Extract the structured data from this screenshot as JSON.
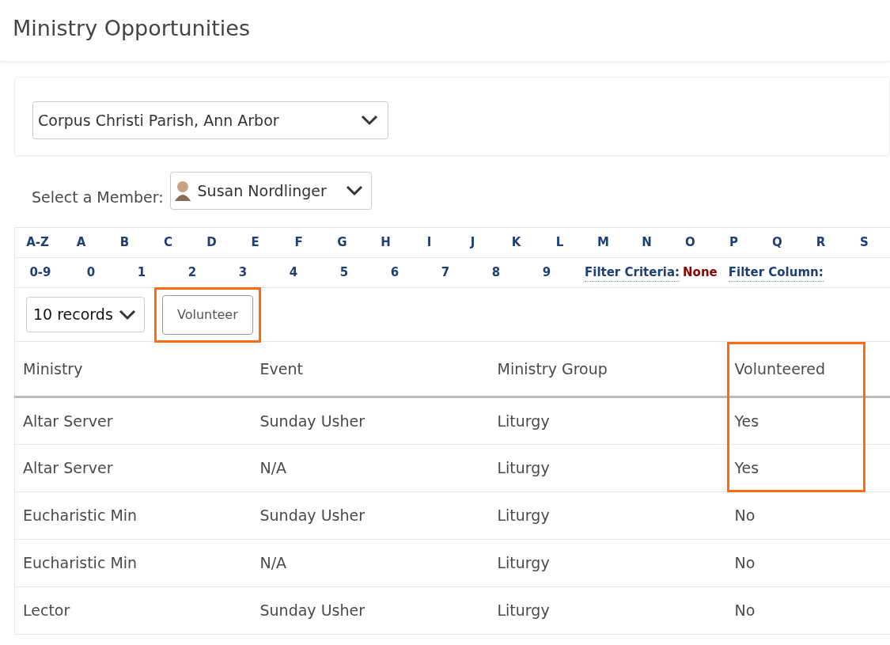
{
  "page_title": "Ministry Opportunities",
  "parish_select": {
    "value": "Corpus Christi Parish, Ann Arbor"
  },
  "member_select": {
    "label": "Select a Member:",
    "value": "Susan Nordlinger"
  },
  "letter_filters": [
    "A-Z",
    "A",
    "B",
    "C",
    "D",
    "E",
    "F",
    "G",
    "H",
    "I",
    "J",
    "K",
    "L",
    "M",
    "N",
    "O",
    "P",
    "Q",
    "R",
    "S"
  ],
  "digit_filters": [
    "0-9",
    "0",
    "1",
    "2",
    "3",
    "4",
    "5",
    "6",
    "7",
    "8",
    "9"
  ],
  "filter_criteria": {
    "label": "Filter Criteria:",
    "value": "None"
  },
  "filter_column": {
    "label": "Filter Column:"
  },
  "records_select": {
    "value": "10 records"
  },
  "volunteer_button": {
    "label": "Volunteer",
    "highlighted": true
  },
  "table": {
    "columns": [
      {
        "label": "Ministry",
        "highlighted": false
      },
      {
        "label": "Event",
        "highlighted": false
      },
      {
        "label": "Ministry Group",
        "highlighted": false
      },
      {
        "label": "Volunteered",
        "highlighted": true
      }
    ],
    "rows": [
      {
        "cells": [
          "Altar Server",
          "Sunday Usher",
          "Liturgy",
          "Yes"
        ],
        "highlighted": true
      },
      {
        "cells": [
          "Altar Server",
          "N/A",
          "Liturgy",
          "Yes"
        ],
        "highlighted": true
      },
      {
        "cells": [
          "Eucharistic Min",
          "Sunday Usher",
          "Liturgy",
          "No"
        ],
        "highlighted": false
      },
      {
        "cells": [
          "Eucharistic Min",
          "N/A",
          "Liturgy",
          "No"
        ],
        "highlighted": false
      },
      {
        "cells": [
          "Lector",
          "Sunday Usher",
          "Liturgy",
          "No"
        ],
        "highlighted": false
      }
    ]
  }
}
